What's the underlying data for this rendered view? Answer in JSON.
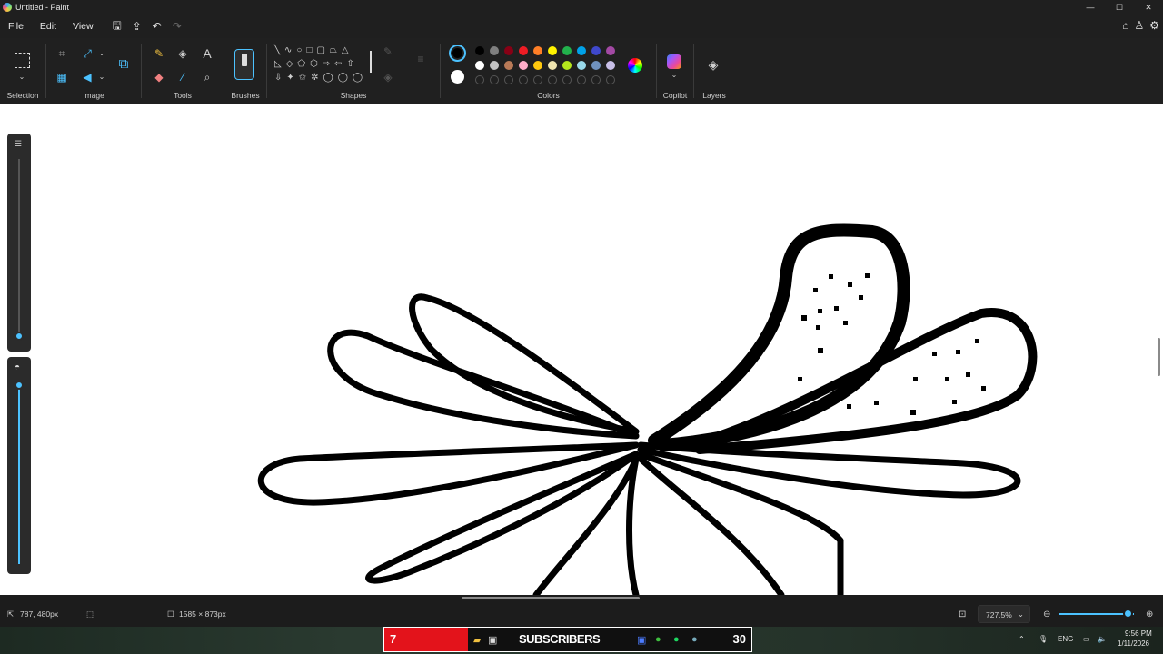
{
  "window": {
    "title": "Untitled - Paint",
    "controls": [
      "—",
      "☐",
      "✕"
    ]
  },
  "menu": {
    "file": "File",
    "edit": "Edit",
    "view": "View"
  },
  "ribbon": {
    "groups": {
      "selection": "Selection",
      "image": "Image",
      "tools": "Tools",
      "brushes": "Brushes",
      "shapes": "Shapes",
      "colors": "Colors",
      "copilot": "Copilot",
      "layers": "Layers"
    },
    "palette_row1": [
      "#000000",
      "#7f7f7f",
      "#880015",
      "#ed1c24",
      "#ff7f27",
      "#fff200",
      "#22b14c",
      "#00a2e8",
      "#3f48cc",
      "#a349a4"
    ],
    "palette_row2": [
      "#ffffff",
      "#c3c3c3",
      "#b97a57",
      "#ffaec9",
      "#ffc90e",
      "#efe4b0",
      "#b5e61d",
      "#99d9ea",
      "#7092be",
      "#c8bfe7"
    ],
    "primary_color": "#000000",
    "secondary_color": "#ffffff"
  },
  "status": {
    "cursor_position": "787, 480px",
    "canvas_size": "1585 × 873px",
    "zoom": "727.5%",
    "zoom_level": 0.85
  },
  "side_sliders": {
    "brush_size_level": 0.0,
    "opacity_level": 1.0
  },
  "taskbar": {
    "count_left": "7",
    "subscribers_label": "SUBSCRIBERS",
    "count_right": "30",
    "lang": "ENG",
    "time": "9:56 PM",
    "date": "1/11/2026"
  }
}
